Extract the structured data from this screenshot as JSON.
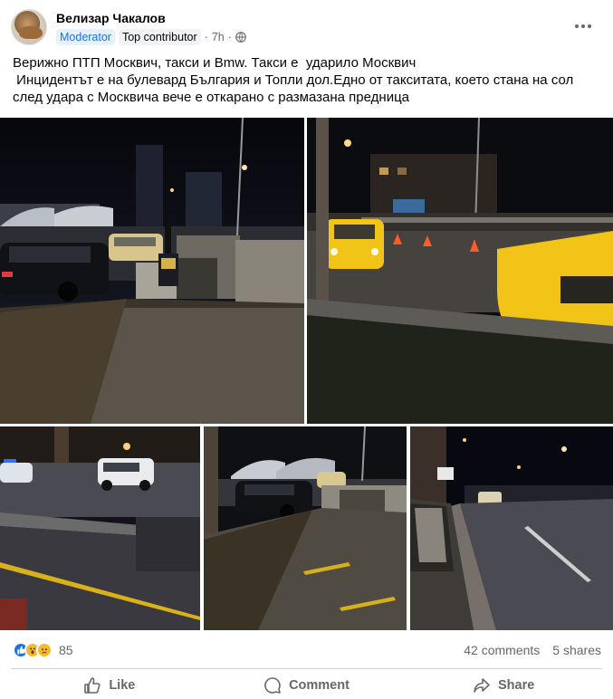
{
  "post": {
    "author": "Велизар Чакалов",
    "badges": {
      "moderator": "Moderator",
      "top_contributor": "Top contributor"
    },
    "time": "7h",
    "separator": "·",
    "text": "Верижно ПТП Москвич, такси и Bmw. Такси е  ударило Москвич\n Инцидентът е на булевард България и Топли дол.Едно от такситата, което стана на сол след удара с Москвича вече е откарано с размазана предница"
  },
  "icons": {
    "avatar": "profile-photo",
    "audience": "globe-icon",
    "more": "more-options-icon",
    "reactions": [
      "like-reaction-icon",
      "wow-reaction-icon",
      "sad-reaction-icon"
    ],
    "like": "thumbs-up-icon",
    "comment": "comment-bubble-icon",
    "share": "share-arrow-icon"
  },
  "photos": [
    {
      "subject": "night street, black BMW, beige Moskvich, underpass stairs"
    },
    {
      "subject": "yellow taxis by the road, traffic cones, green median"
    },
    {
      "subject": "police car and white SUV on lit street"
    },
    {
      "subject": "black BMW beside underpass railing"
    },
    {
      "subject": "long night boulevard with stair entrance"
    }
  ],
  "stats": {
    "reactions_count": "85",
    "comments": "42 comments",
    "shares": "5 shares"
  },
  "actions": {
    "like": "Like",
    "comment": "Comment",
    "share": "Share"
  },
  "colors": {
    "accent": "#1b74e4",
    "taxi_yellow": "#f2c418",
    "muted_text": "#65676b"
  }
}
